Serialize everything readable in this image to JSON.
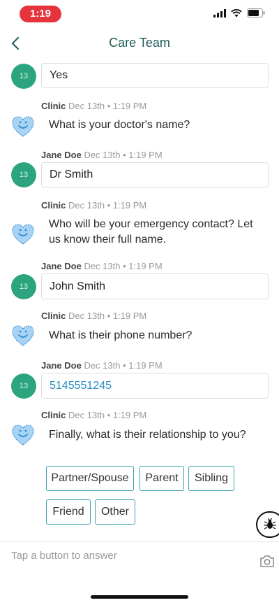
{
  "status_bar": {
    "time": "1:19"
  },
  "header": {
    "title": "Care Team"
  },
  "messages": [
    {
      "sender": "",
      "timestamp": "",
      "text": "Yes"
    },
    {
      "sender": "Clinic",
      "timestamp": "Dec 13th • 1:19 PM",
      "text": "What is your doctor's name?"
    },
    {
      "sender": "Jane Doe",
      "timestamp": "Dec 13th • 1:19 PM",
      "text": "Dr Smith"
    },
    {
      "sender": "Clinic",
      "timestamp": "Dec 13th • 1:19 PM",
      "text": "Who will be your emergency contact? Let us know their full name."
    },
    {
      "sender": "Jane Doe",
      "timestamp": "Dec 13th • 1:19 PM",
      "text": "John Smith"
    },
    {
      "sender": "Clinic",
      "timestamp": "Dec 13th • 1:19 PM",
      "text": "What is their phone number?"
    },
    {
      "sender": "Jane Doe",
      "timestamp": "Dec 13th • 1:19 PM",
      "text": "5145551245"
    },
    {
      "sender": "Clinic",
      "timestamp": "Dec 13th • 1:19 PM",
      "text": "Finally, what is their relationship to you?"
    }
  ],
  "user_avatar_text": "13",
  "quick_replies": [
    "Partner/Spouse",
    "Parent",
    "Sibling",
    "Friend",
    "Other"
  ],
  "composer": {
    "placeholder": "Tap a button to answer"
  },
  "colors": {
    "accent": "#1e5b5a",
    "avatar_green": "#2ca57f",
    "chip_border": "#3aa0b3",
    "clinic_blue": "#2b8fd6",
    "link": "#2a8fc5"
  },
  "icons": {
    "back": "chevron-left-icon",
    "clinic": "heart-smile-icon",
    "bug": "bug-icon",
    "camera": "camera-icon"
  }
}
